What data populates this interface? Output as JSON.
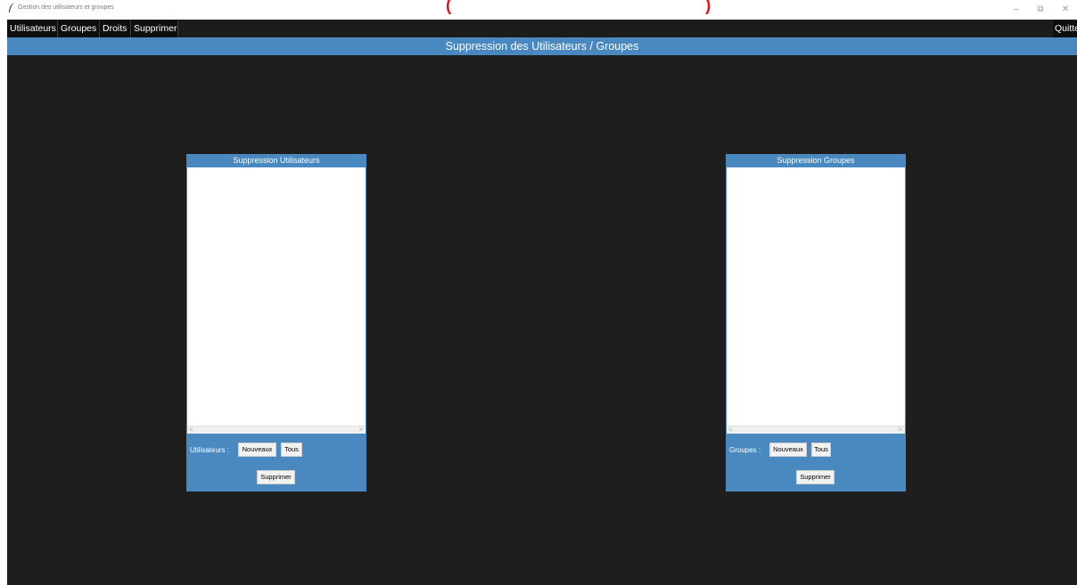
{
  "window": {
    "title": "Gestion des utilisateurs et groupes",
    "overlay_left": "(",
    "overlay_right": ")",
    "controls": {
      "minimize": "–",
      "restore": "⧉",
      "close": "✕"
    }
  },
  "menu": {
    "items": [
      "Utilisateurs",
      "Groupes",
      "Droits",
      "Supprimer"
    ],
    "quit": "Quitter"
  },
  "header": {
    "title": "Suppression des Utilisateurs / Groupes"
  },
  "users_panel": {
    "title": "Suppression Utilisateurs",
    "label": "Utilisateurs :",
    "new_button": "Nouveaux",
    "all_button": "Tous",
    "delete_button": "Supprimer"
  },
  "groups_panel": {
    "title": "Suppression Groupes",
    "label": "Groupes :",
    "new_button": "Nouveaux",
    "all_button": "Tous",
    "delete_button": "Supprimer"
  },
  "scroll": {
    "left": "<",
    "right": ">"
  },
  "colors": {
    "accent": "#4a89bf",
    "background": "#1e1e1e",
    "menubar": "#0e0e0e",
    "overlay_text": "#ee1111"
  }
}
